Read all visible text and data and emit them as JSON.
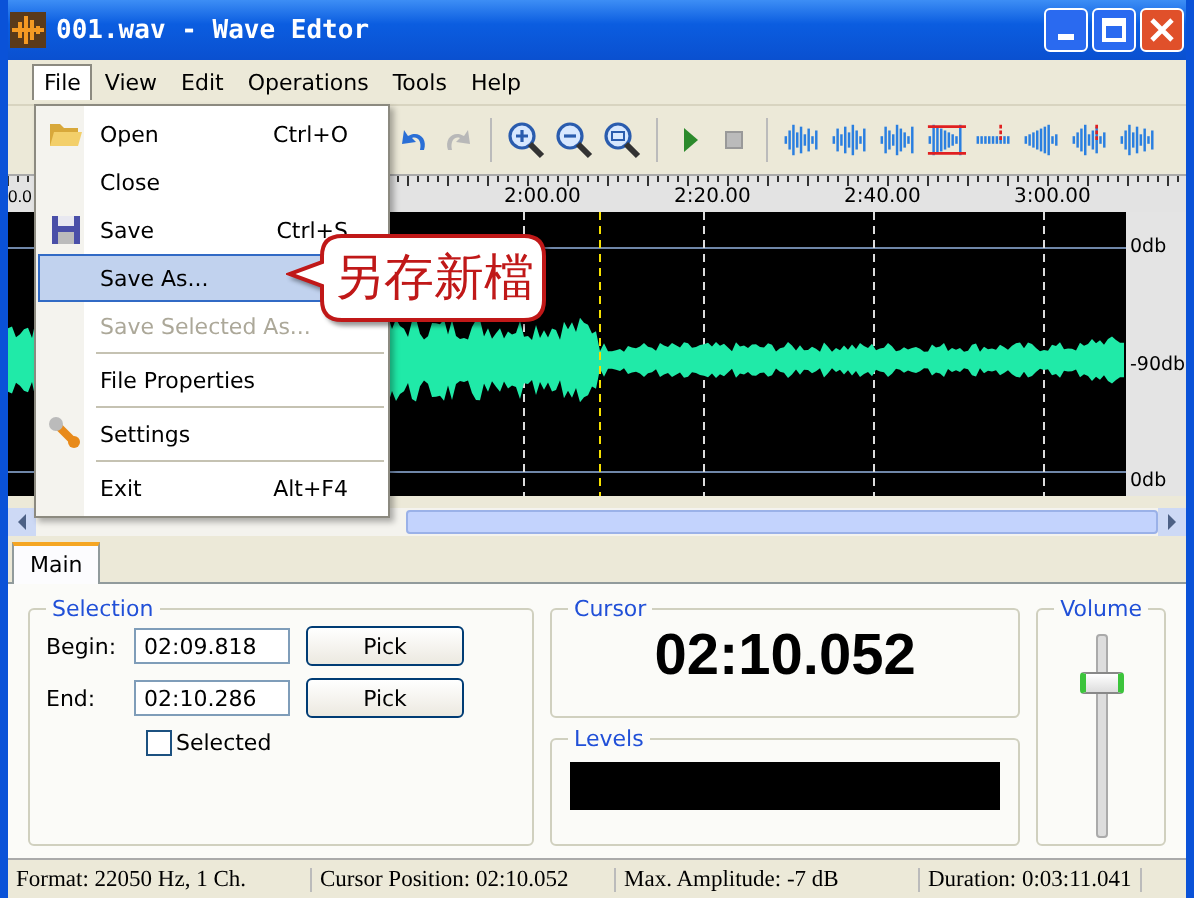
{
  "window": {
    "title": "001.wav - Wave Edtor"
  },
  "menubar": [
    {
      "label": "File",
      "selected": true
    },
    {
      "label": "View",
      "selected": false
    },
    {
      "label": "Edit",
      "selected": false
    },
    {
      "label": "Operations",
      "selected": false
    },
    {
      "label": "Tools",
      "selected": false
    },
    {
      "label": "Help",
      "selected": false
    }
  ],
  "file_menu": [
    {
      "label": "Open",
      "shortcut": "Ctrl+O",
      "selected": false,
      "disabled": false,
      "separator_after": false
    },
    {
      "label": "Close",
      "selected": false,
      "disabled": false,
      "separator_after": false
    },
    {
      "label": "Save",
      "shortcut": "Ctrl+S",
      "selected": false,
      "disabled": false,
      "separator_after": false
    },
    {
      "label": "Save As...",
      "selected": true,
      "disabled": false,
      "separator_after": false
    },
    {
      "label": "Save Selected As...",
      "selected": false,
      "disabled": true,
      "separator_after": true
    },
    {
      "label": "File Properties",
      "selected": false,
      "disabled": false,
      "separator_after": true
    },
    {
      "label": "Settings",
      "selected": false,
      "disabled": false,
      "separator_after": true
    },
    {
      "label": "Exit",
      "shortcut": "Alt+F4",
      "selected": false,
      "disabled": false,
      "separator_after": false
    }
  ],
  "callout": "另存新檔",
  "ruler": [
    "0.0",
    "2:00.00",
    "2:20.00",
    "2:40.00",
    "3:00.00"
  ],
  "db_labels": [
    "0db",
    "-90db",
    "0db"
  ],
  "tabs": [
    {
      "label": "Main",
      "selected": true
    }
  ],
  "selection": {
    "title": "Selection",
    "begin_label": "Begin:",
    "begin": "02:09.818",
    "end_label": "End:",
    "end": "02:10.286",
    "pick": [
      "Pick",
      "Pick"
    ],
    "checkbox": {
      "label": "Selected",
      "checked": false
    }
  },
  "cursor": {
    "title": "Cursor",
    "time": "02:10.052"
  },
  "levels": {
    "title": "Levels"
  },
  "volume": {
    "title": "Volume",
    "level": 0.78
  },
  "status_bar": [
    "Format: 22050 Hz, 1 Ch.",
    "Cursor Position: 02:10.052",
    "Max. Amplitude: -7 dB",
    "Duration: 0:03:11.041"
  ]
}
